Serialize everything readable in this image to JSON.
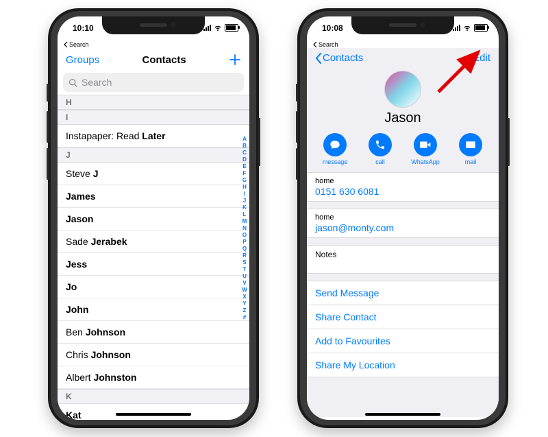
{
  "left": {
    "status_time": "10:10",
    "crumb": "Search",
    "nav": {
      "groups": "Groups",
      "title": "Contacts"
    },
    "search_placeholder": "Search",
    "sections": [
      {
        "letter": "H",
        "rows": []
      },
      {
        "letter": "I",
        "rows": [
          "Instapaper: Read Later"
        ]
      },
      {
        "letter": "J",
        "rows": [
          "Steve J",
          "James",
          "Jason",
          "Sade Jerabek",
          "Jess",
          "Jo",
          "John",
          "Ben Johnson",
          "Chris Johnson",
          "Albert Johnston"
        ]
      },
      {
        "letter": "K",
        "rows": [
          "Kat"
        ]
      }
    ],
    "index": [
      "A",
      "B",
      "C",
      "D",
      "E",
      "F",
      "G",
      "H",
      "I",
      "J",
      "K",
      "L",
      "M",
      "N",
      "O",
      "P",
      "Q",
      "R",
      "S",
      "T",
      "U",
      "V",
      "W",
      "X",
      "Y",
      "Z",
      "#"
    ]
  },
  "right": {
    "status_time": "10:08",
    "crumb": "Search",
    "nav": {
      "back": "Contacts",
      "edit": "Edit"
    },
    "name": "Jason",
    "actions": [
      {
        "key": "message",
        "label": "message"
      },
      {
        "key": "call",
        "label": "call"
      },
      {
        "key": "whatsapp",
        "label": "WhatsApp"
      },
      {
        "key": "mail",
        "label": "mail"
      }
    ],
    "phone": {
      "label": "home",
      "value": "0151 630 6081"
    },
    "email": {
      "label": "home",
      "value": "jason@monty.com"
    },
    "notes_label": "Notes",
    "links": [
      "Send Message",
      "Share Contact",
      "Add to Favourites",
      "Share My Location"
    ]
  }
}
